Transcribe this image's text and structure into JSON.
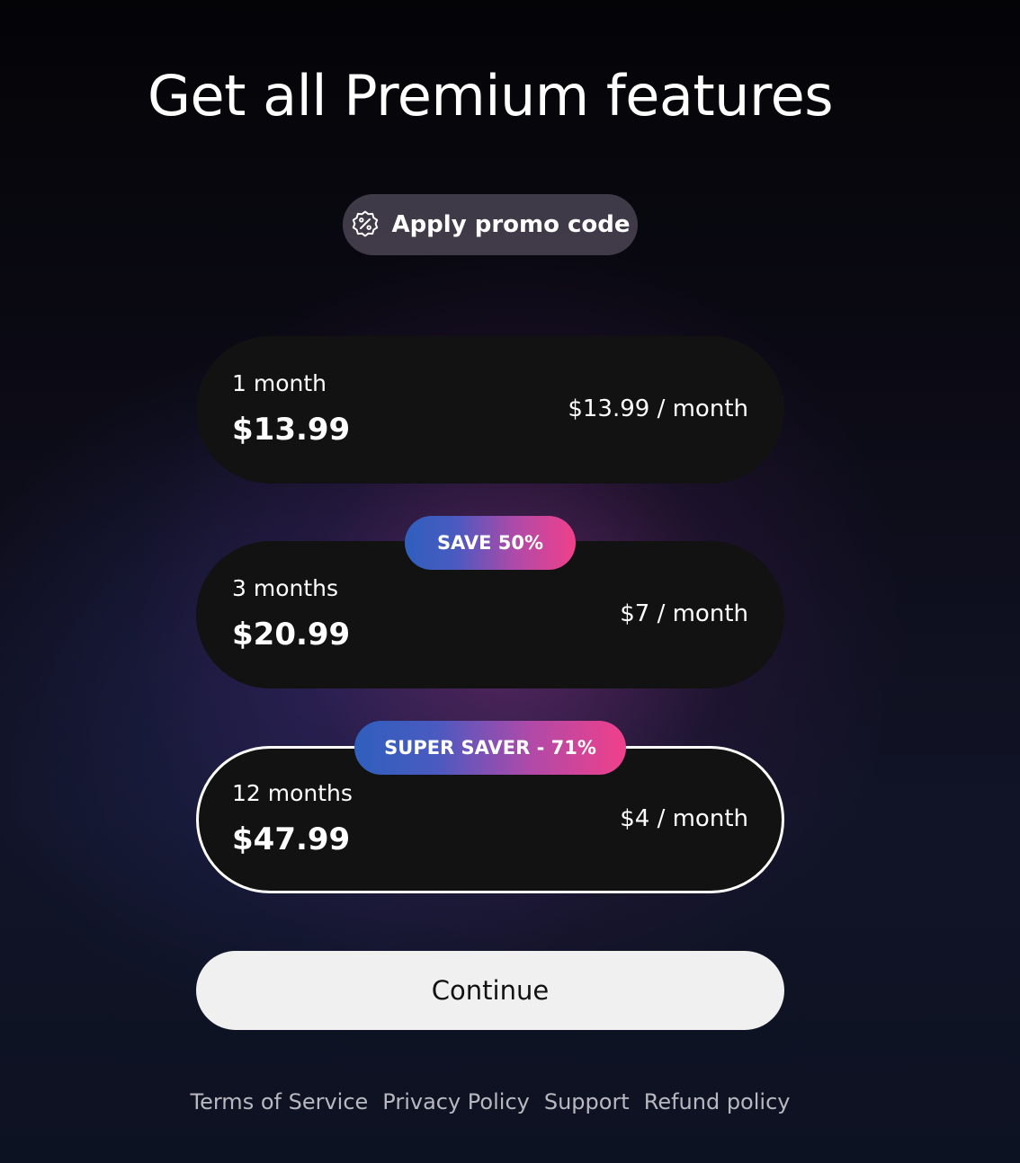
{
  "header": {
    "title": "Get all Premium features"
  },
  "promo": {
    "label": "Apply promo code",
    "icon": "discount-badge-icon"
  },
  "plans": [
    {
      "period": "1 month",
      "price": "$13.99",
      "monthly": "$13.99 / month",
      "badge": "",
      "selected": false
    },
    {
      "period": "3 months",
      "price": "$20.99",
      "monthly": "$7 / month",
      "badge": "SAVE 50%",
      "selected": false
    },
    {
      "period": "12 months",
      "price": "$47.99",
      "monthly": "$4 / month",
      "badge": "SUPER SAVER - 71%",
      "selected": true
    }
  ],
  "cta": {
    "label": "Continue"
  },
  "footer": {
    "links": [
      "Terms of Service",
      "Privacy Policy",
      "Support",
      "Refund policy"
    ]
  },
  "colors": {
    "badge_gradient_start": "#2f5fbd",
    "badge_gradient_end": "#f0408a",
    "card_background": "#121212",
    "cta_background": "#f0f0f0"
  }
}
